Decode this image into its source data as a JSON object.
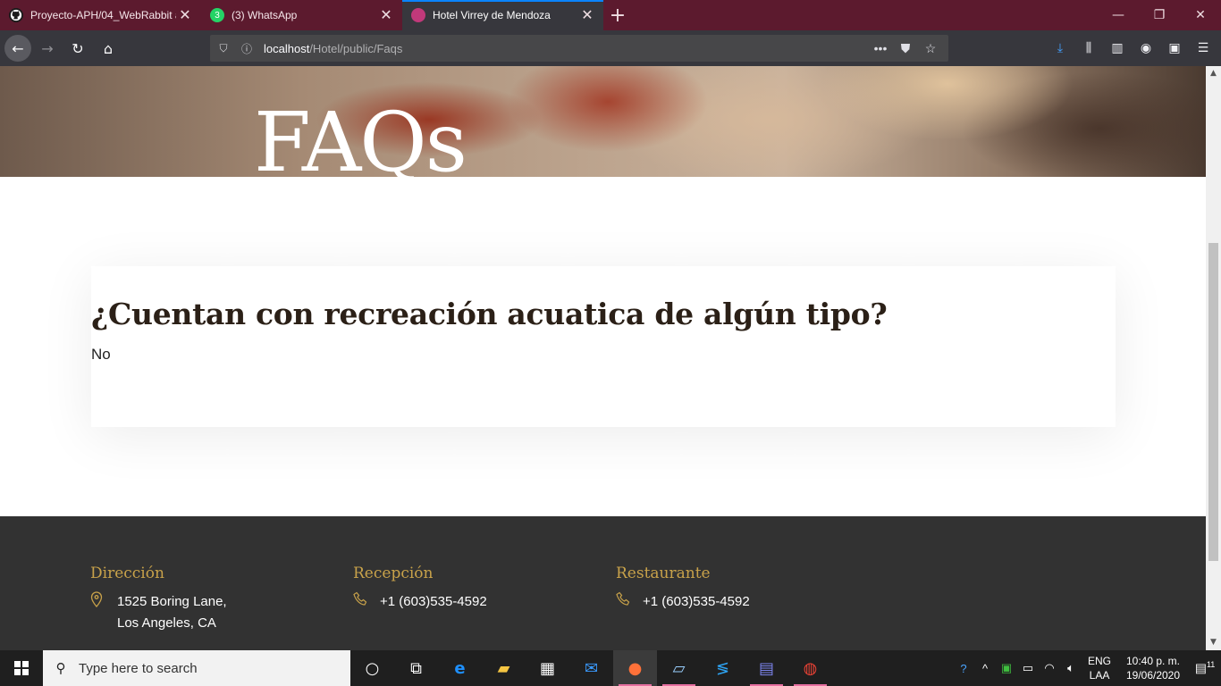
{
  "browser": {
    "tabs": [
      {
        "title": "Proyecto-APH/04_WebRabbit a",
        "icon": "github-icon",
        "active": false
      },
      {
        "title": "(3) WhatsApp",
        "icon": "whatsapp-icon",
        "badge": "3",
        "active": false
      },
      {
        "title": "Hotel Virrey de Mendoza",
        "icon": "site-favicon",
        "active": true
      }
    ],
    "new_tab_label": "+",
    "url_host": "localhost",
    "url_path": "/Hotel/public/Faqs"
  },
  "page": {
    "hero_title": "FAQs",
    "faq": {
      "question": "¿Cuentan con recreación acuatica de algún tipo?",
      "answer": "No"
    },
    "footer": {
      "address": {
        "heading": "Dirección",
        "line1": "1525 Boring Lane,",
        "line2": "Los Angeles, CA"
      },
      "reception": {
        "heading": "Recepción",
        "phone": "+1 (603)535-4592"
      },
      "restaurant": {
        "heading": "Restaurante",
        "phone": "+1 (603)535-4592"
      }
    },
    "colors": {
      "accent": "#c8a24a",
      "footer_bg": "#323232",
      "tab_bar": "#5c1a2e"
    }
  },
  "taskbar": {
    "search_placeholder": "Type here to search",
    "lang_line1": "ENG",
    "lang_line2": "LAA",
    "time": "10:40 p. m.",
    "date": "19/06/2020",
    "notification_count": "11"
  }
}
